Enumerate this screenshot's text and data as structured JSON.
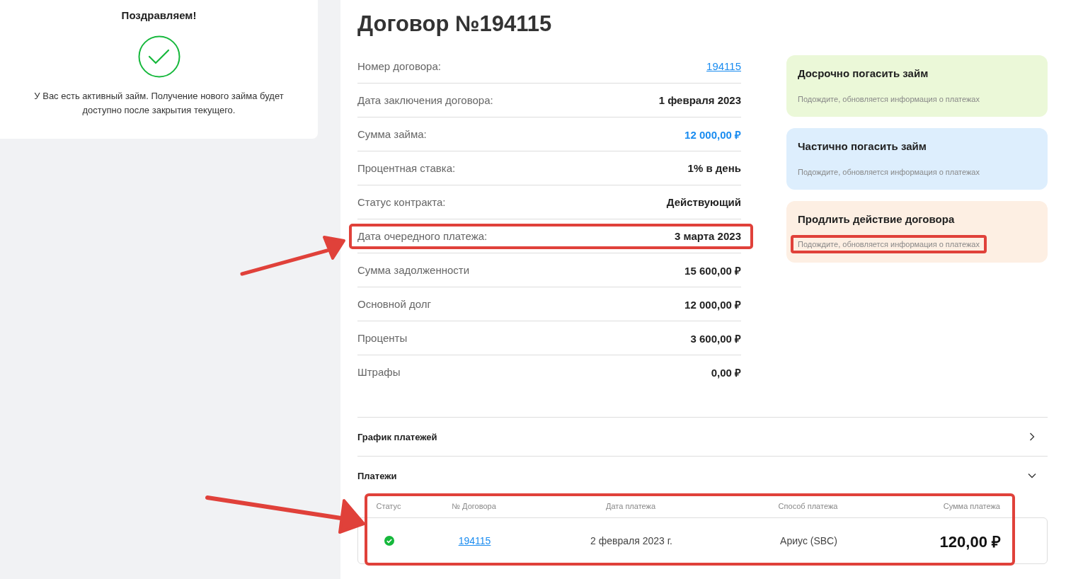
{
  "notice": {
    "title": "Поздравляем!",
    "text": "У Вас есть активный займ. Получение нового займа будет доступно после закрытия текущего."
  },
  "contract": {
    "title": "Договор №194115",
    "details": [
      {
        "label": "Номер договора:",
        "value": "194115",
        "kind": "link",
        "highlighted": false
      },
      {
        "label": "Дата заключения договора:",
        "value": "1 февраля 2023",
        "kind": "bold",
        "highlighted": false
      },
      {
        "label": "Сумма займа:",
        "value": "12 000,00 ₽",
        "kind": "accent",
        "highlighted": false
      },
      {
        "label": "Процентная ставка:",
        "value": "1% в день",
        "kind": "bold",
        "highlighted": false
      },
      {
        "label": "Статус контракта:",
        "value": "Действующий",
        "kind": "bold",
        "highlighted": false
      },
      {
        "label": "Дата очередного платежа:",
        "value": "3 марта 2023",
        "kind": "bold",
        "highlighted": true
      },
      {
        "label": "Сумма задолженности",
        "value": "15 600,00 ₽",
        "kind": "bold",
        "highlighted": false
      },
      {
        "label": "Основной долг",
        "value": "12 000,00 ₽",
        "kind": "bold",
        "highlighted": false
      },
      {
        "label": "Проценты",
        "value": "3 600,00 ₽",
        "kind": "bold",
        "highlighted": false
      },
      {
        "label": "Штрафы",
        "value": "0,00 ₽",
        "kind": "bold",
        "highlighted": false
      }
    ],
    "actions": [
      {
        "title": "Досрочно погасить займ",
        "note": "Подождите, обновляется информация о платежах",
        "color": "#ebf8d8",
        "highlighted": false
      },
      {
        "title": "Частично погасить займ",
        "note": "Подождите, обновляется информация о платежах",
        "color": "#ddeefd",
        "highlighted": false
      },
      {
        "title": "Продлить действие договора",
        "note": "Подождите, обновляется информация о платежах",
        "color": "#fdefe3",
        "highlighted": true
      }
    ]
  },
  "sections": [
    {
      "title": "График платежей",
      "expanded": false
    },
    {
      "title": "Платежи",
      "expanded": true
    }
  ],
  "payments": {
    "highlighted": true,
    "columns": [
      "Статус",
      "№ Договора",
      "Дата платежа",
      "Способ платежа",
      "Сумма платежа"
    ],
    "rows": [
      {
        "paid": true,
        "contract": "194115",
        "date": "2 февраля 2023 г.",
        "method": "Ариус (SBC)",
        "amount": "120,00 ₽"
      }
    ]
  }
}
